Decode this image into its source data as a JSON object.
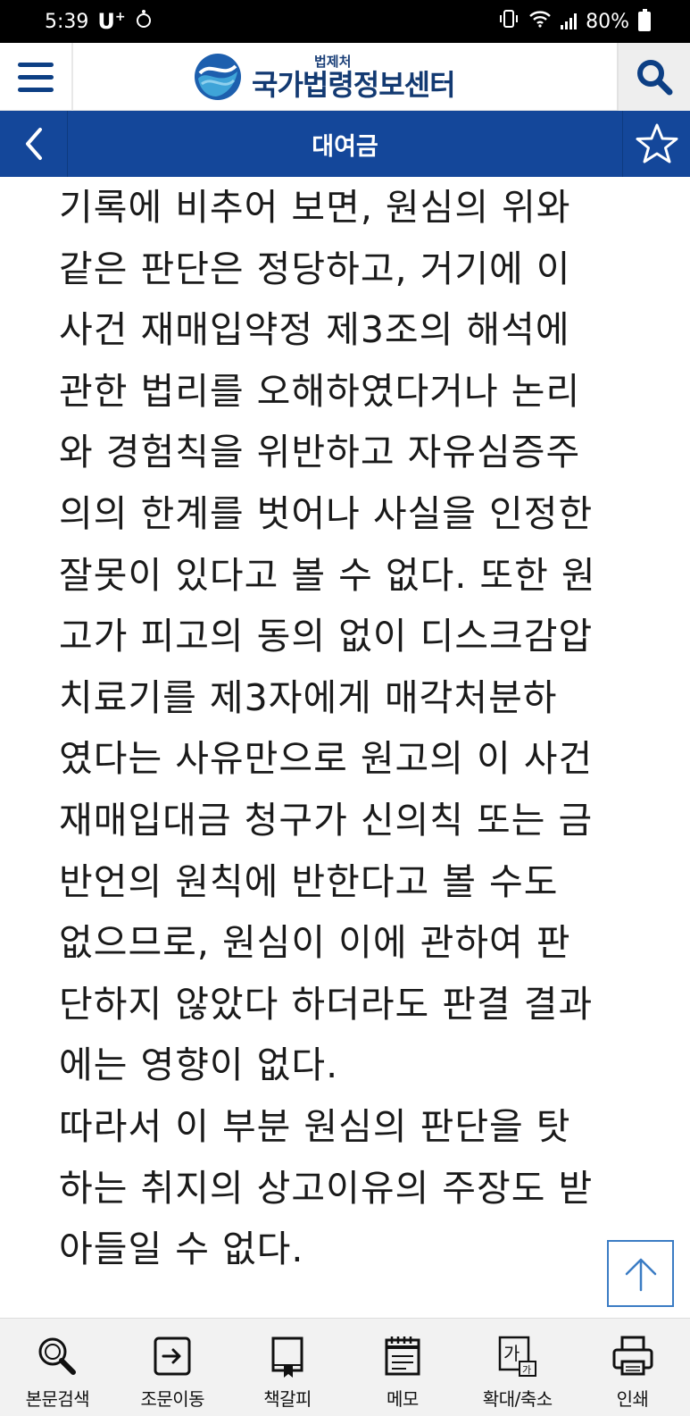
{
  "status_bar": {
    "time": "5:39",
    "carrier": "U",
    "carrier_sup": "+",
    "battery": "80%"
  },
  "header": {
    "logo_sub": "법제처",
    "logo_main": "국가법령정보센터"
  },
  "title_bar": {
    "title": "대여금"
  },
  "content": {
    "lines": [
      "기록에 비추어 보면, 원심의 위와",
      "같은 판단은 정당하고, 거기에 이",
      "사건 재매입약정 제3조의 해석에",
      "관한 법리를 오해하였다거나 논리",
      "와 경험칙을 위반하고 자유심증주",
      "의의 한계를 벗어나 사실을 인정한",
      "잘못이 있다고 볼 수 없다. 또한 원",
      "고가 피고의 동의 없이 디스크감압",
      "치료기를 제3자에게 매각처분하",
      "였다는 사유만으로 원고의 이 사건",
      "재매입대금 청구가 신의칙 또는 금",
      "반언의 원칙에 반한다고 볼 수도",
      "없으므로, 원심이 이에 관하여 판",
      "단하지 않았다 하더라도 판결 결과",
      "에는 영향이 없다.",
      "따라서 이 부분 원심의 판단을 탓",
      "하는 취지의 상고이유의 주장도 받",
      "아들일 수 없다."
    ]
  },
  "toolbar": {
    "items": [
      {
        "label": "본문검색",
        "icon": "search-icon"
      },
      {
        "label": "조문이동",
        "icon": "move-article-icon"
      },
      {
        "label": "책갈피",
        "icon": "bookmark-book-icon"
      },
      {
        "label": "메모",
        "icon": "memo-icon"
      },
      {
        "label": "확대/축소",
        "icon": "font-size-icon",
        "icon_text": "가"
      },
      {
        "label": "인쇄",
        "icon": "printer-icon"
      }
    ]
  },
  "colors": {
    "title_bar": "#14479a",
    "menu_icon": "#0d3f84",
    "scroll_button_border": "#3b7cc4"
  }
}
